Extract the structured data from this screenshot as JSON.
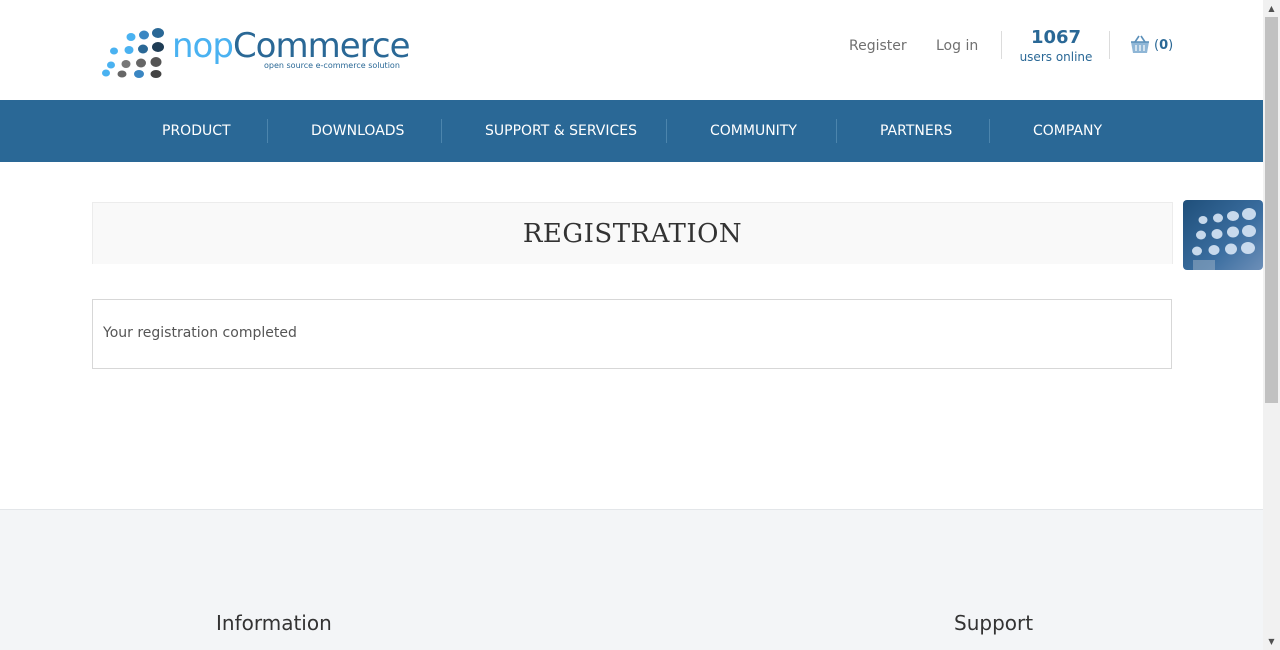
{
  "header": {
    "logo": {
      "nop": "nop",
      "commerce": "Commerce",
      "tagline": "open source e-commerce solution"
    },
    "links": {
      "register": "Register",
      "login": "Log in"
    },
    "online": {
      "count": "1067",
      "label": "users online"
    },
    "cart": {
      "open_paren": "(",
      "count": "0",
      "close_paren": ")"
    }
  },
  "nav": {
    "items": [
      "PRODUCT",
      "DOWNLOADS",
      "SUPPORT & SERVICES",
      "COMMUNITY",
      "PARTNERS",
      "COMPANY"
    ]
  },
  "main": {
    "title": "REGISTRATION",
    "result": "Your registration completed"
  },
  "footer": {
    "information": "Information",
    "support": "Support"
  },
  "colors": {
    "brand_blue": "#2a6896",
    "logo_light_blue": "#4ab2f1",
    "footer_bg": "#f3f5f7"
  }
}
